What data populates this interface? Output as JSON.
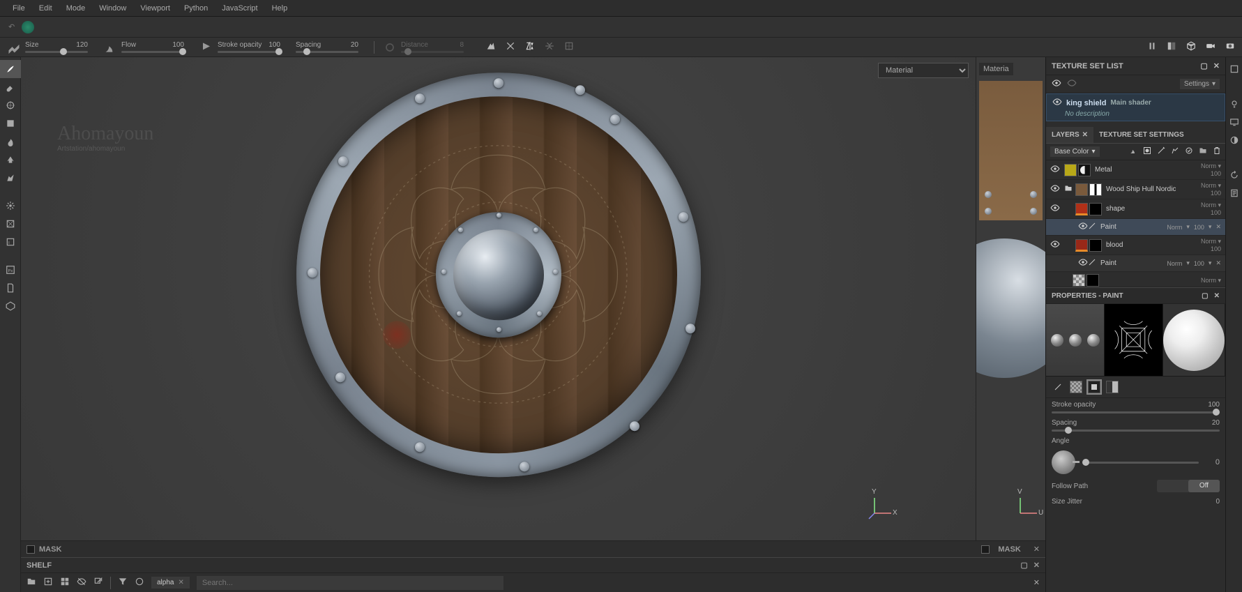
{
  "menu": {
    "items": [
      "File",
      "Edit",
      "Mode",
      "Window",
      "Viewport",
      "Python",
      "JavaScript",
      "Help"
    ]
  },
  "toolOptions": {
    "size": {
      "label": "Size",
      "value": 120
    },
    "flow": {
      "label": "Flow",
      "value": 100
    },
    "strokeOpacity": {
      "label": "Stroke opacity",
      "value": 100
    },
    "spacing": {
      "label": "Spacing",
      "value": 20
    },
    "distance": {
      "label": "Distance",
      "value": 8
    }
  },
  "viewport3d": {
    "materialCombo": "Material",
    "watermarkName": "Ahomayoun",
    "watermarkSub": "Artstation/ahomayoun",
    "axisX": "X",
    "axisY": "Y",
    "axisU": "U",
    "axisV": "V"
  },
  "viewport2d": {
    "tab": "Materia"
  },
  "mask": {
    "label": "MASK"
  },
  "shelf": {
    "title": "SHELF",
    "chip": "alpha",
    "searchPlaceholder": "Search..."
  },
  "textureSetList": {
    "title": "TEXTURE SET LIST",
    "settings": "Settings",
    "item": {
      "name": "king shield",
      "desc": "No description",
      "shader": "Main shader"
    }
  },
  "layersPanel": {
    "tabLayers": "LAYERS",
    "tabTextureSettings": "TEXTURE SET SETTINGS",
    "channelCombo": "Base Color",
    "layers": [
      {
        "name": "Metal",
        "swatch": "#b8a818",
        "mask": "moon",
        "blend": "Norm",
        "opacity": 100
      },
      {
        "name": "Wood Ship Hull Nordic",
        "swatch": "#7a5a3c",
        "mask": "bw",
        "blend": "Norm",
        "opacity": 100,
        "folder": true
      },
      {
        "name": "shape",
        "swatch": "#b03018",
        "mask": "#000",
        "blend": "Norm",
        "opacity": 100,
        "paint": {
          "name": "Paint",
          "blend": "Norm",
          "opacity": 100,
          "selected": true
        }
      },
      {
        "name": "blood",
        "swatch": "#982818",
        "mask": "#000",
        "blend": "Norm",
        "opacity": 100,
        "paint": {
          "name": "Paint",
          "blend": "Norm",
          "opacity": 100
        }
      },
      {
        "name": "",
        "checker": true,
        "mask": "#000",
        "blend": "Norm",
        "opacity": ""
      }
    ]
  },
  "properties": {
    "title": "PROPERTIES - PAINT",
    "strokeOpacity": {
      "label": "Stroke opacity",
      "value": 100
    },
    "spacing": {
      "label": "Spacing",
      "value": 20
    },
    "angle": {
      "label": "Angle",
      "value": 0
    },
    "followPath": {
      "label": "Follow Path",
      "value": "Off"
    },
    "sizeJitter": {
      "label": "Size Jitter",
      "value": 0
    }
  }
}
